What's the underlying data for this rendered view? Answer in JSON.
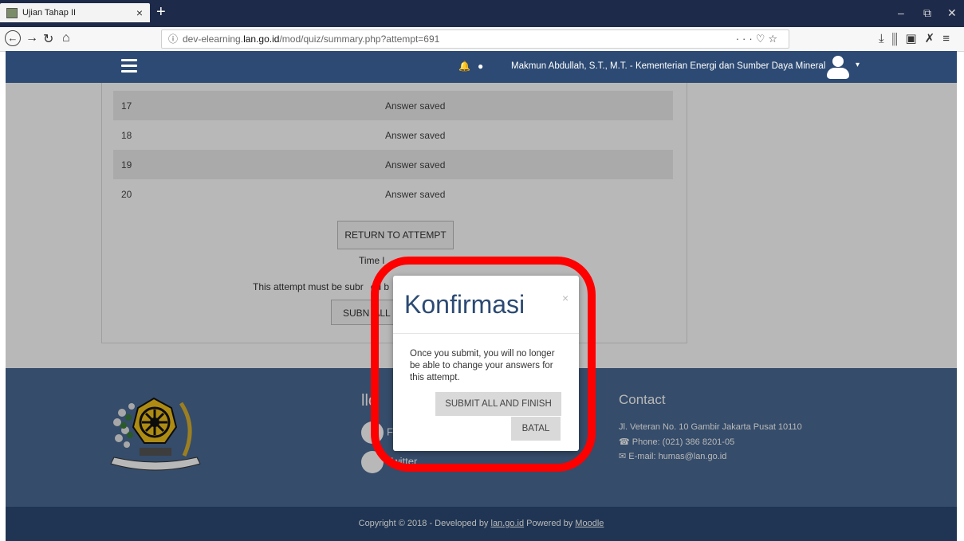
{
  "browser": {
    "tab_title": "Ujian Tahap II",
    "tab_close": "×",
    "new_tab": "+",
    "url_prefix": "dev-elearning.",
    "url_domain": "lan.go.id",
    "url_path": "/mod/quiz/summary.php?attempt=691",
    "window_controls": {
      "minimize": "–",
      "maximize": "⧉",
      "close": "✕"
    }
  },
  "header": {
    "user_name": "Makmun Abdullah, S.T., M.T. - Kementerian Energi dan Sumber Daya Mineral"
  },
  "summary": {
    "rows": [
      {
        "number": "17",
        "status": "Answer saved"
      },
      {
        "number": "18",
        "status": "Answer saved"
      },
      {
        "number": "19",
        "status": "Answer saved"
      },
      {
        "number": "20",
        "status": "Answer saved"
      }
    ],
    "return_button": "RETURN TO ATTEMPT",
    "time_left_visible": "Time l",
    "must_submit_visible": "This attempt must be subr",
    "must_submit_visible_2": "ed b",
    "submit_button_visible": "SUBN",
    "submit_button_visible_2": "ALL"
  },
  "footer": {
    "follow_title_visible": "llo",
    "social": [
      {
        "label_visible": "F"
      },
      {
        "label_visible": "Twitter"
      }
    ],
    "contact_title": "Contact",
    "address": "Jl. Veteran No. 10 Gambir Jakarta Pusat 10110",
    "phone": "Phone: (021) 386 8201-05",
    "email_label": "E-mail: ",
    "email": "humas@lan.go.id",
    "copyright_prefix": "Copyright © 2018 - Developed by ",
    "copyright_site": "lan.go.id",
    "copyright_powered": " Powered by ",
    "copyright_moodle": "Moodle"
  },
  "modal": {
    "title": "Konfirmasi",
    "close": "×",
    "message": "Once you submit, you will no longer be able to change your answers for this attempt.",
    "submit_button": "SUBMIT ALL AND FINISH",
    "cancel_button": "BATAL"
  },
  "colors": {
    "header_bg": "#2c4a73",
    "footer_bg": "#4a6a93",
    "highlight": "#ff0000"
  }
}
